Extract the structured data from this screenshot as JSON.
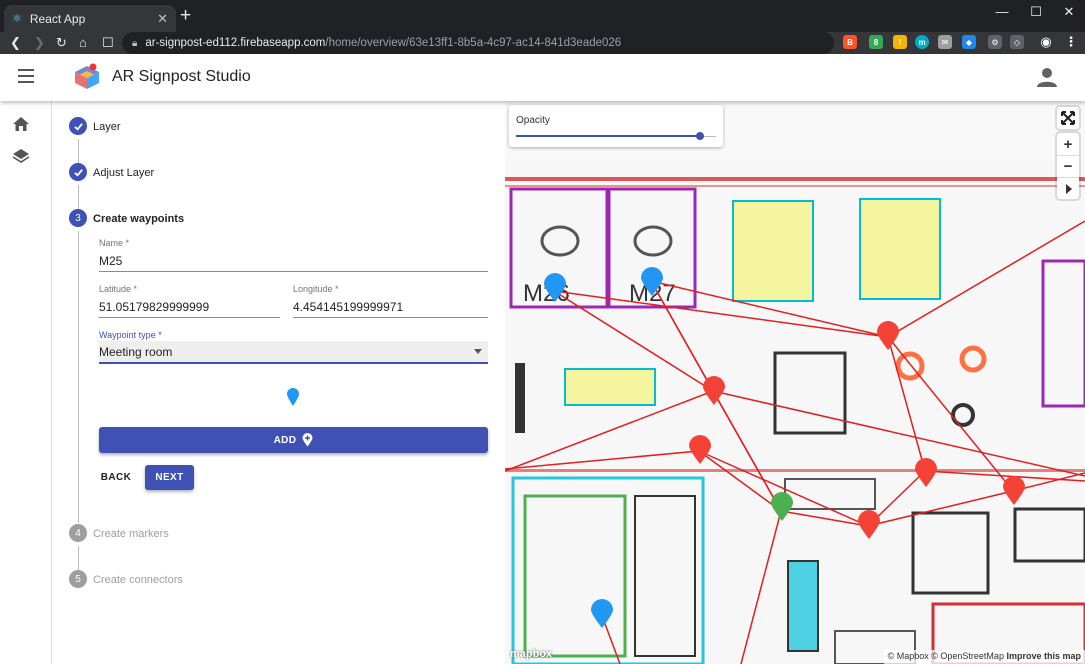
{
  "browser": {
    "tab_title": "React App",
    "url_host": "ar-signpost-ed112.firebaseapp.com",
    "url_path": "/home/overview/63e13ff1-8b5a-4c97-ac14-841d3eade026"
  },
  "app": {
    "title": "AR Signpost Studio"
  },
  "stepper": {
    "steps": [
      {
        "number": "1",
        "label": "Layer",
        "state": "completed"
      },
      {
        "number": "2",
        "label": "Adjust Layer",
        "state": "completed"
      },
      {
        "number": "3",
        "label": "Create waypoints",
        "state": "active"
      },
      {
        "number": "4",
        "label": "Create markers",
        "state": "inactive"
      },
      {
        "number": "5",
        "label": "Create connectors",
        "state": "inactive"
      }
    ]
  },
  "form": {
    "name_label": "Name *",
    "name_value": "M25",
    "latitude_label": "Latitude *",
    "latitude_value": "51.05179829999999",
    "longitude_label": "Longitude *",
    "longitude_value": "4.454145199999971",
    "waypoint_type_label": "Waypoint type *",
    "waypoint_type_value": "Meeting room",
    "add_label": "ADD",
    "back_label": "BACK",
    "next_label": "NEXT"
  },
  "map": {
    "opacity_label": "Opacity",
    "opacity_value": 0.92,
    "zoom_in": "+",
    "zoom_out": "−",
    "room_labels": [
      "M26",
      "M27"
    ],
    "logo_text": "mapbox",
    "attribution": "© Mapbox © OpenStreetMap",
    "improve_link": "Improve this map"
  },
  "colors": {
    "primary": "#3f51b5",
    "waypoint_blue": "#2196f3",
    "waypoint_red": "#f44336",
    "waypoint_green": "#4caf50",
    "connector": "#e02020"
  }
}
